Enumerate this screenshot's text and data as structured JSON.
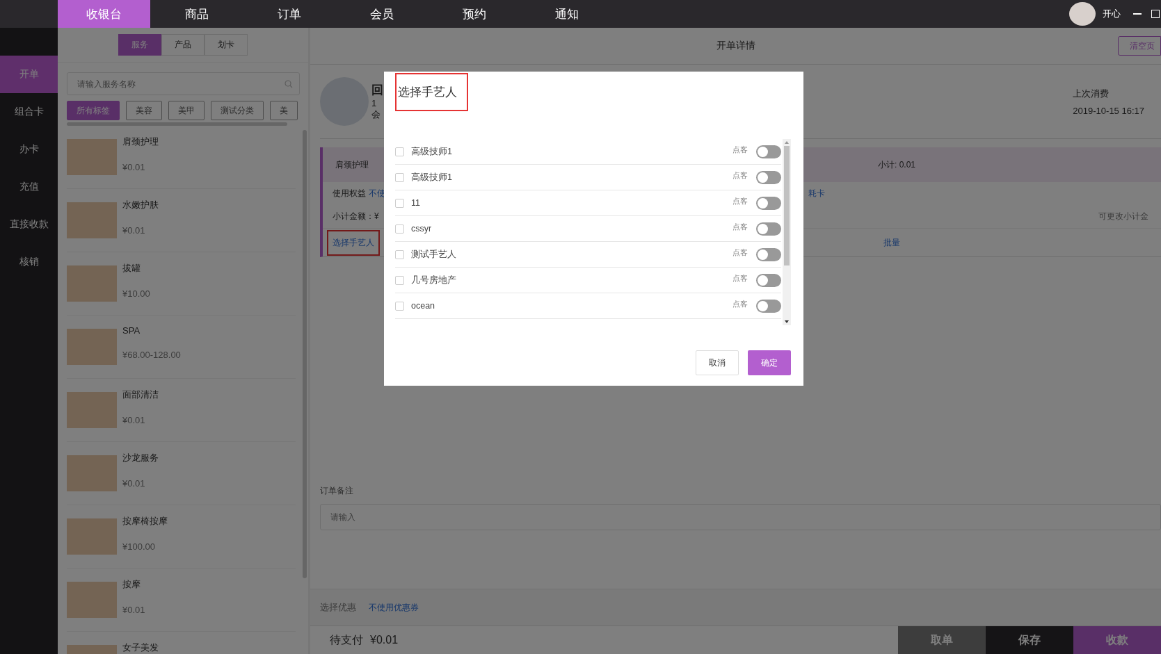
{
  "top_nav": {
    "tabs": [
      {
        "label": "收银台",
        "selected": true
      },
      {
        "label": "商品",
        "selected": false
      },
      {
        "label": "订单",
        "selected": false
      },
      {
        "label": "会员",
        "selected": false
      },
      {
        "label": "预约",
        "selected": false
      },
      {
        "label": "通知",
        "selected": false
      }
    ],
    "user": {
      "name": "开心"
    }
  },
  "sidebar": {
    "items": [
      {
        "label": "开单",
        "selected": true
      },
      {
        "label": "组合卡",
        "selected": false
      },
      {
        "label": "办卡",
        "selected": false
      },
      {
        "label": "充值",
        "selected": false
      },
      {
        "label": "直接收款",
        "selected": false
      },
      {
        "label": "核销",
        "selected": false
      }
    ]
  },
  "catalog": {
    "tabs": [
      {
        "label": "服务",
        "selected": true
      },
      {
        "label": "产品",
        "selected": false
      },
      {
        "label": "划卡",
        "selected": false
      }
    ],
    "search": {
      "placeholder": "请输入服务名称"
    },
    "tags": [
      {
        "label": "所有标签",
        "selected": true
      },
      {
        "label": "美容",
        "selected": false
      },
      {
        "label": "美甲",
        "selected": false
      },
      {
        "label": "测试分类",
        "selected": false
      },
      {
        "label": "美",
        "selected": false
      }
    ],
    "items": [
      {
        "name": "肩颈护理",
        "price": "¥0.01"
      },
      {
        "name": "水嫩护肤",
        "price": "¥0.01"
      },
      {
        "name": "拔罐",
        "price": "¥10.00"
      },
      {
        "name": "SPA",
        "price": "¥68.00-128.00"
      },
      {
        "name": "面部清洁",
        "price": "¥0.01"
      },
      {
        "name": "沙龙服务",
        "price": "¥0.01"
      },
      {
        "name": "按摩椅按摩",
        "price": "¥100.00"
      },
      {
        "name": "按摩",
        "price": "¥0.01"
      },
      {
        "name": "女子美发"
      }
    ]
  },
  "order": {
    "title": "开单详情",
    "clear_button": "清空页",
    "member": {
      "name": "回",
      "line_2": "1",
      "line_3": "会"
    },
    "last_visit": {
      "label": "上次消费",
      "value": "2019-10-15 16:17"
    },
    "line_item": {
      "name": "肩颈护理",
      "subtotal": "小计: 0.01",
      "benefit_label": "使用权益",
      "benefit_value": "不使",
      "card_link": "耗卡",
      "amount_label": "小计金额：¥",
      "amount_hint": "可更改小计金",
      "artisan_link": {
        "label": "选择手艺人",
        "highlighted": true
      },
      "batch_link": "批量"
    },
    "remark": {
      "label": "订单备注",
      "placeholder": "请输入"
    },
    "discount": {
      "label": "选择优惠",
      "value": "不使用优惠券"
    },
    "footer": {
      "due_label": "待支付",
      "due_value": "¥0.01",
      "buttons": [
        {
          "label": "取单",
          "kind": "grey"
        },
        {
          "label": "保存",
          "kind": "dark"
        },
        {
          "label": "收款",
          "kind": "primary"
        }
      ]
    }
  },
  "dialog": {
    "title": "选择手艺人",
    "title_highlighted": true,
    "artisans": [
      {
        "name": "高级技师1",
        "checked": false,
        "tag": "点客",
        "on": false
      },
      {
        "name": "高级技师1",
        "checked": false,
        "tag": "点客",
        "on": false
      },
      {
        "name": "11",
        "checked": false,
        "tag": "点客",
        "on": false
      },
      {
        "name": "cssyr",
        "checked": false,
        "tag": "点客",
        "on": false
      },
      {
        "name": "测试手艺人",
        "checked": false,
        "tag": "点客",
        "on": false
      },
      {
        "name": "几号房地产",
        "checked": false,
        "tag": "点客",
        "on": false
      },
      {
        "name": "ocean",
        "checked": false,
        "tag": "点客",
        "on": false
      }
    ],
    "buttons": [
      {
        "label": "取消",
        "kind": "secondary"
      },
      {
        "label": "确定",
        "kind": "primary"
      }
    ]
  }
}
